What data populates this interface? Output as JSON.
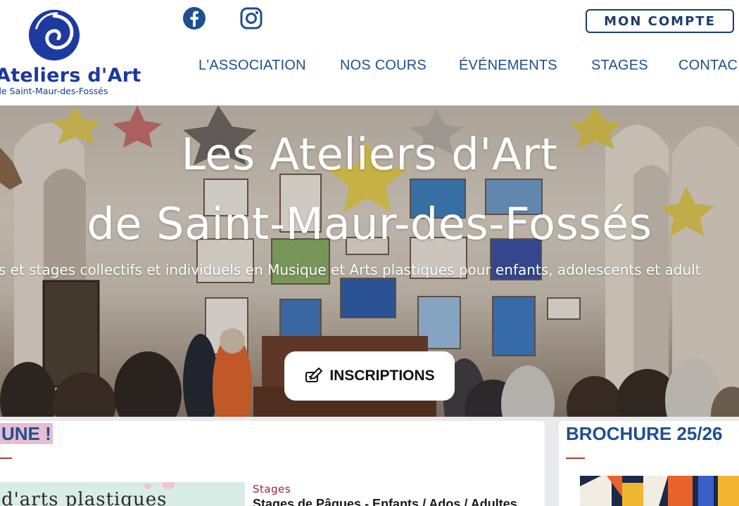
{
  "header": {
    "logo": {
      "title": "Ateliers d'Art",
      "subtitle": "de Saint-Maur-des-Fossés"
    },
    "social": [
      {
        "name": "facebook-icon",
        "color": "#1d4f91"
      },
      {
        "name": "instagram-icon",
        "color": "#1d4f91"
      }
    ],
    "account_button": "MON COMPTE",
    "nav": [
      {
        "label": "L'ASSOCIATION"
      },
      {
        "label": "NOS COURS"
      },
      {
        "label": "ÉVÉNEMENTS"
      },
      {
        "label": "STAGES"
      },
      {
        "label": "CONTAC"
      }
    ]
  },
  "hero": {
    "title_line1": "Les Ateliers d'Art",
    "title_line2": "de Saint-Maur-des-Fossés",
    "subtitle": "urs et stages collectifs et individuels en Musique et Arts plastiques pour enfants, adolescents et adult",
    "cta_label": "INSCRIPTIONS",
    "cta_icon": "edit-icon"
  },
  "une_section": {
    "heading": "UNE !",
    "thumbnail_text": "d'arts plastiques",
    "category": "Stages",
    "item_title": "Stages de Pâques - Enfants / Ados / Adultes"
  },
  "brochure_section": {
    "heading": "BROCHURE 25/26"
  },
  "colors": {
    "brand_blue": "#1f4f8f",
    "accent_red": "#c0392b",
    "highlight_pink": "#e6bdd2"
  }
}
